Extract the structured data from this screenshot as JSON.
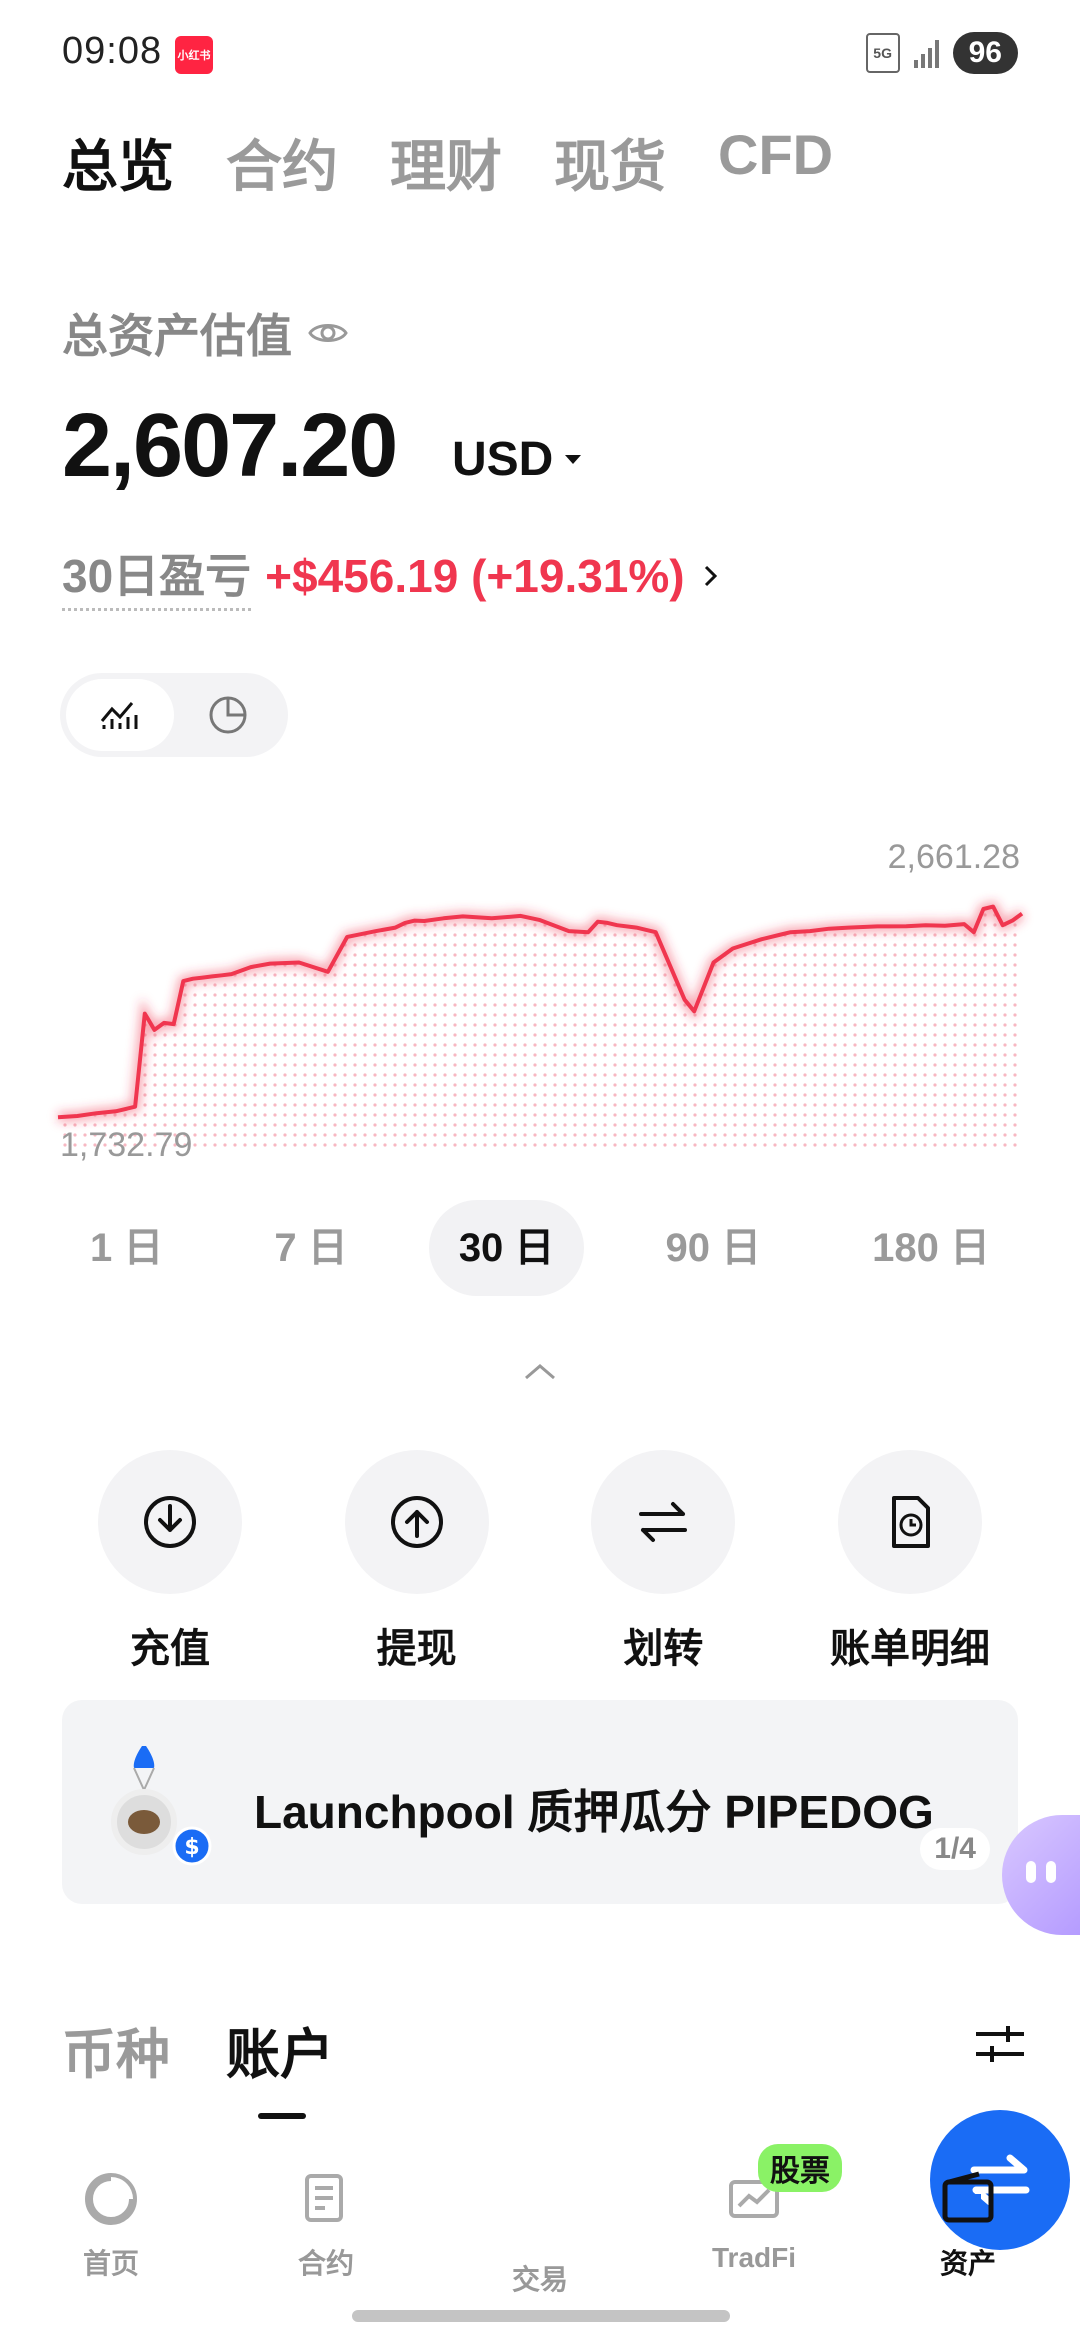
{
  "status": {
    "time": "09:08",
    "app_badge": "小红书",
    "network": "5G",
    "battery": "96"
  },
  "top_tabs": [
    {
      "label": "总览",
      "active": true
    },
    {
      "label": "合约",
      "active": false
    },
    {
      "label": "理财",
      "active": false
    },
    {
      "label": "现货",
      "active": false
    },
    {
      "label": "CFD",
      "active": false
    }
  ],
  "asset": {
    "label": "总资产估值",
    "value": "2,607.20",
    "currency": "USD",
    "pnl_label": "30日盈亏",
    "pnl_value": "+$456.19 (+19.31%)"
  },
  "chart_data": {
    "type": "line",
    "max_label": "2,661.28",
    "min_label": "1,732.79",
    "ylim": [
      1732.79,
      2661.28
    ],
    "x": [
      0,
      2,
      4,
      6,
      8,
      9,
      10,
      11,
      12,
      13,
      14,
      15,
      16,
      17,
      18,
      20,
      22,
      25,
      28,
      30,
      33,
      35,
      36,
      37,
      38,
      40,
      42,
      45,
      48,
      50,
      53,
      55,
      56,
      57,
      58,
      60,
      62,
      65,
      66,
      68,
      70,
      73,
      75,
      76,
      78,
      80,
      82,
      85,
      88,
      90,
      92,
      94,
      95,
      96,
      97,
      98,
      99,
      100
    ],
    "values": [
      1745,
      1750,
      1762,
      1770,
      1790,
      2190,
      2120,
      2150,
      2145,
      2330,
      2340,
      2345,
      2350,
      2355,
      2360,
      2390,
      2405,
      2410,
      2370,
      2520,
      2545,
      2560,
      2580,
      2590,
      2588,
      2600,
      2608,
      2600,
      2610,
      2592,
      2545,
      2540,
      2585,
      2580,
      2570,
      2560,
      2540,
      2250,
      2200,
      2410,
      2470,
      2510,
      2530,
      2540,
      2545,
      2555,
      2560,
      2565,
      2566,
      2570,
      2568,
      2575,
      2540,
      2640,
      2650,
      2570,
      2590,
      2620
    ],
    "color": "#f0364f",
    "grid": false
  },
  "periods": [
    {
      "label": "1 日",
      "active": false
    },
    {
      "label": "7 日",
      "active": false
    },
    {
      "label": "30 日",
      "active": true
    },
    {
      "label": "90 日",
      "active": false
    },
    {
      "label": "180 日",
      "active": false
    }
  ],
  "actions": [
    {
      "label": "充值",
      "icon": "deposit-icon"
    },
    {
      "label": "提现",
      "icon": "withdraw-icon"
    },
    {
      "label": "划转",
      "icon": "transfer-icon"
    },
    {
      "label": "账单明细",
      "icon": "bill-icon"
    }
  ],
  "banner": {
    "text": "Launchpool 质押瓜分 PIPEDOG",
    "page": "1/4"
  },
  "sub_tabs": [
    {
      "label": "币种",
      "active": false
    },
    {
      "label": "账户",
      "active": true
    }
  ],
  "bottom_nav": [
    {
      "label": "首页",
      "icon": "home-icon"
    },
    {
      "label": "合约",
      "icon": "contract-icon"
    },
    {
      "label": "交易",
      "icon": "trade-icon"
    },
    {
      "label": "TradFi",
      "icon": "tradfi-icon",
      "badge": "股票"
    },
    {
      "label": "资产",
      "icon": "wallet-icon",
      "active": true
    }
  ],
  "colors": {
    "accent_red": "#f0364f",
    "brand_blue": "#1a6cf5",
    "badge_green": "#8af266"
  }
}
